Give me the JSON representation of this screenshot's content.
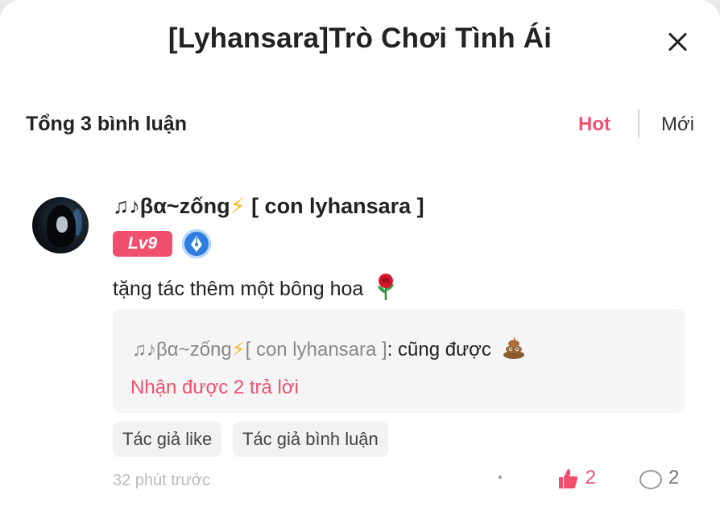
{
  "header": {
    "title": "[Lyhansara]Trò Chơi Tình Ái"
  },
  "comments_section": {
    "total_label": "Tổng 3 bình luận",
    "sort_options": [
      "Hot",
      "Mới"
    ],
    "active_sort": "Hot"
  },
  "comment": {
    "user_name_prefix": "♫♪βα~zống",
    "user_name_suffix": "[ con lyhansara ]",
    "level": "Lv9",
    "text": "tặng tác thêm một bông hoa",
    "reply": {
      "user_name_prefix": "♫♪βα~zống",
      "user_name_suffix": "[ con lyhansara ]",
      "text": ": cũng được",
      "more_label": "Nhận được 2 trả lời"
    },
    "tags": [
      "Tác giả like",
      "Tác giả bình luận"
    ],
    "time": "32 phút trước",
    "like_count": "2",
    "reply_count": "2"
  },
  "colors": {
    "accent": "#f0506e",
    "badge_blue": "#2f7de0",
    "reply_bg": "#f5f5f5"
  }
}
